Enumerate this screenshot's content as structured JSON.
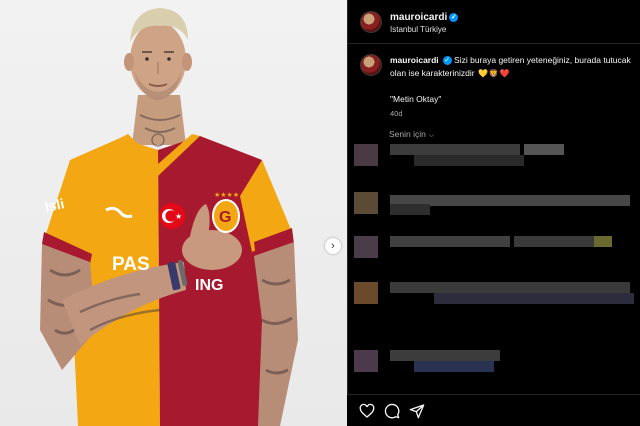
{
  "post": {
    "username": "mauroicardi",
    "location": "Istanbul Türkiye",
    "caption": "Sizi buraya getiren yeteneğiniz, burada tutucak olan ise karakterinizdir",
    "caption_emojis": [
      "💛",
      "🦁",
      "❤️"
    ],
    "quote": "\"Metin Oktay\"",
    "age": "40d"
  },
  "jersey": {
    "sponsor_text": "PAS",
    "sponsor_text_2": "ING",
    "sleeve_text": "lsli"
  },
  "comments": {
    "filter_label": "Senin için"
  },
  "colors": {
    "jersey_red": "#a6192e",
    "jersey_yellow": "#f3a712",
    "verified_blue": "#0095f6"
  },
  "icons": [
    "verified-icon",
    "next-arrow-icon",
    "heart-icon",
    "comment-icon",
    "share-icon",
    "chevron-down-icon"
  ]
}
